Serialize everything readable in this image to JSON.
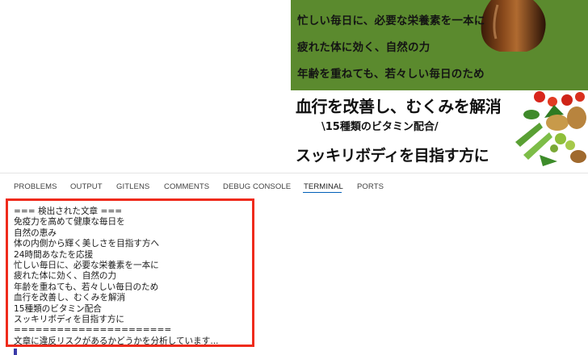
{
  "banner_green": {
    "line1": "忙しい毎日に、必要な栄養素を一本に",
    "line2": "疲れた体に効く、自然の力",
    "line3": "年齢を重ねても、若々しい毎日のため",
    "background": "#5b8a2e"
  },
  "banner_white": {
    "headline": "血行を改善し、むくみを解消",
    "sub": "\\15種類のビタミン配合/",
    "bottom": "スッキリボディを目指す方に"
  },
  "panel": {
    "tabs": [
      {
        "label": "PROBLEMS"
      },
      {
        "label": "OUTPUT"
      },
      {
        "label": "GITLENS"
      },
      {
        "label": "COMMENTS"
      },
      {
        "label": "DEBUG CONSOLE"
      },
      {
        "label": "TERMINAL",
        "active": true
      },
      {
        "label": "PORTS"
      }
    ]
  },
  "terminal": {
    "lines": [
      "=== 検出された文章 ===",
      "免疫力を高めて健康な毎日を",
      "自然の恵み",
      "体の内側から輝く美しさを目指す方へ",
      "24時間あなたを応援",
      "忙しい毎日に、必要な栄養素を一本に",
      "疲れた体に効く、自然の力",
      "年齢を重ねても、若々しい毎日のため",
      "血行を改善し、むくみを解消",
      "15種類のビタミン配合",
      "スッキリボディを目指す方に",
      "======================",
      "文章に違反リスクがあるかどうかを分析しています..."
    ],
    "highlight_color": "#ef2b1c"
  }
}
